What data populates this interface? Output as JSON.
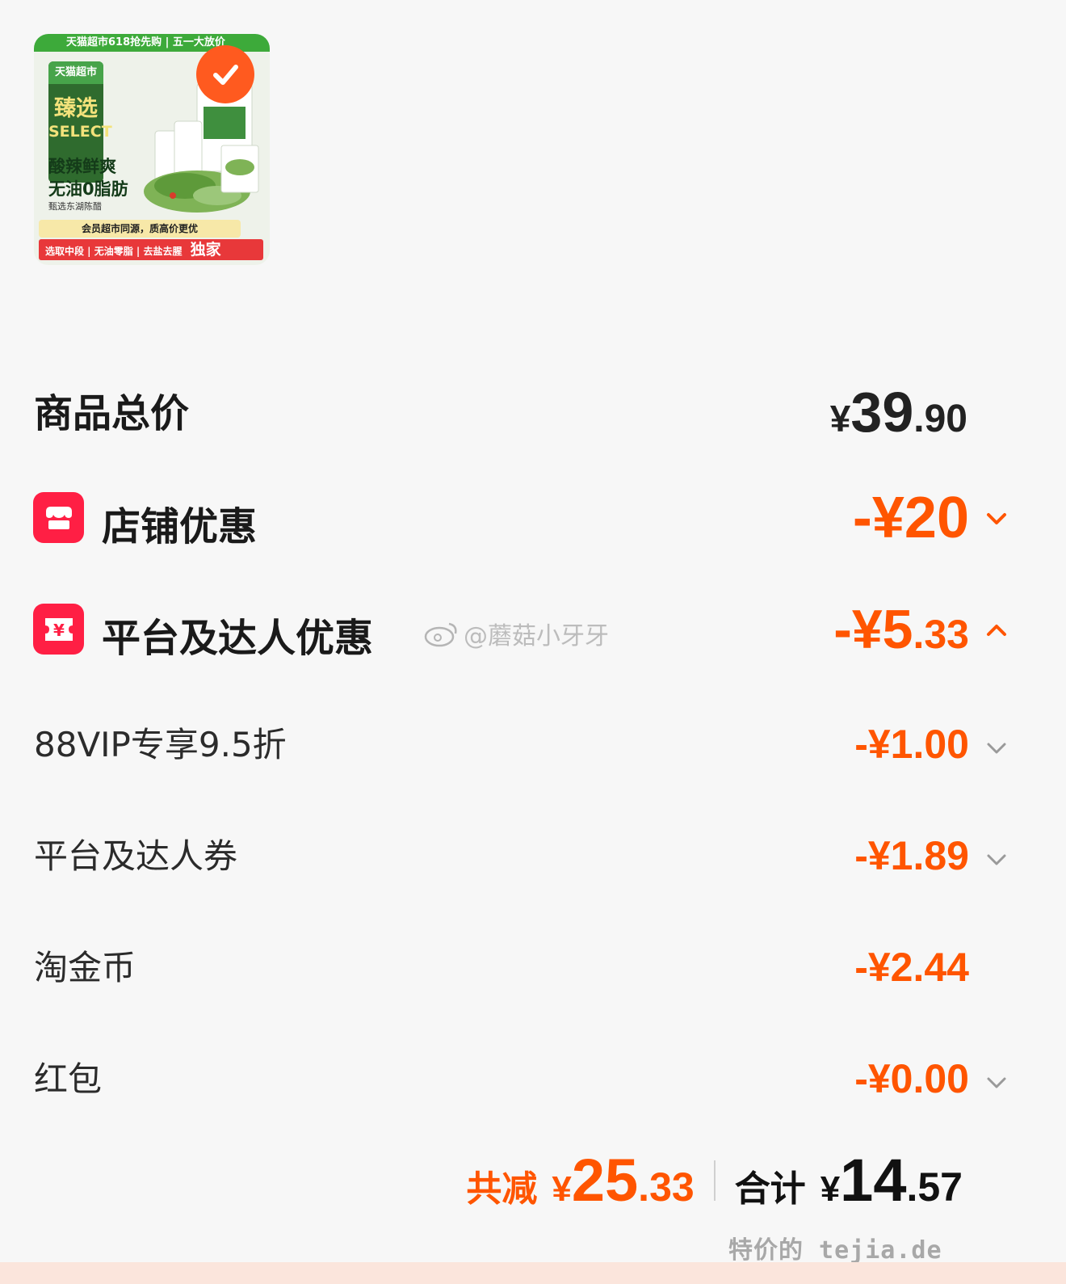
{
  "product": {
    "image_topbar": "天猫超市618抢先购 | 五一大放价",
    "badge_top": "天猫超市",
    "badge_title": "臻选",
    "badge_sub": "SELECT",
    "slogan_line1": "酸辣鲜爽",
    "slogan_line2": "无油0脂肪",
    "small_text": "甄选东湖陈醋",
    "bottom_line1": "会员超市同源，质高价更优",
    "bottom_line2": "选取中段 | 无油零脂 | 去盐去腥",
    "exclusive_tag": "独家",
    "selected": true
  },
  "total_price": {
    "label": "商品总价",
    "yen": "¥",
    "integer": "39",
    "decimal": ".90"
  },
  "store_discount": {
    "label": "店铺优惠",
    "amount": "-¥20",
    "expanded": false
  },
  "platform_discount": {
    "label": "平台及达人优惠",
    "amount_main": "-¥5",
    "amount_decimal": ".33",
    "expanded": true,
    "items": [
      {
        "label": "88VIP专享9.5折",
        "amount": "-¥1.00",
        "has_chevron": true
      },
      {
        "label": "平台及达人券",
        "amount": "-¥1.89",
        "has_chevron": true
      },
      {
        "label": "淘金币",
        "amount": "-¥2.44",
        "has_chevron": false
      },
      {
        "label": "红包",
        "amount": "-¥0.00",
        "has_chevron": true
      }
    ]
  },
  "watermark": "@蘑菇小牙牙",
  "summary": {
    "discount_label": "共减",
    "discount_yen": "¥",
    "discount_int": "25",
    "discount_dec": ".33",
    "total_label": "合计",
    "total_yen": "¥",
    "total_int": "14",
    "total_dec": ".57"
  },
  "site_mark": "特价的 tejia.de",
  "colors": {
    "accent": "#ff5500",
    "icon_red": "#ff1f44",
    "background": "#f7f7f7",
    "check": "#ff5a1f"
  }
}
